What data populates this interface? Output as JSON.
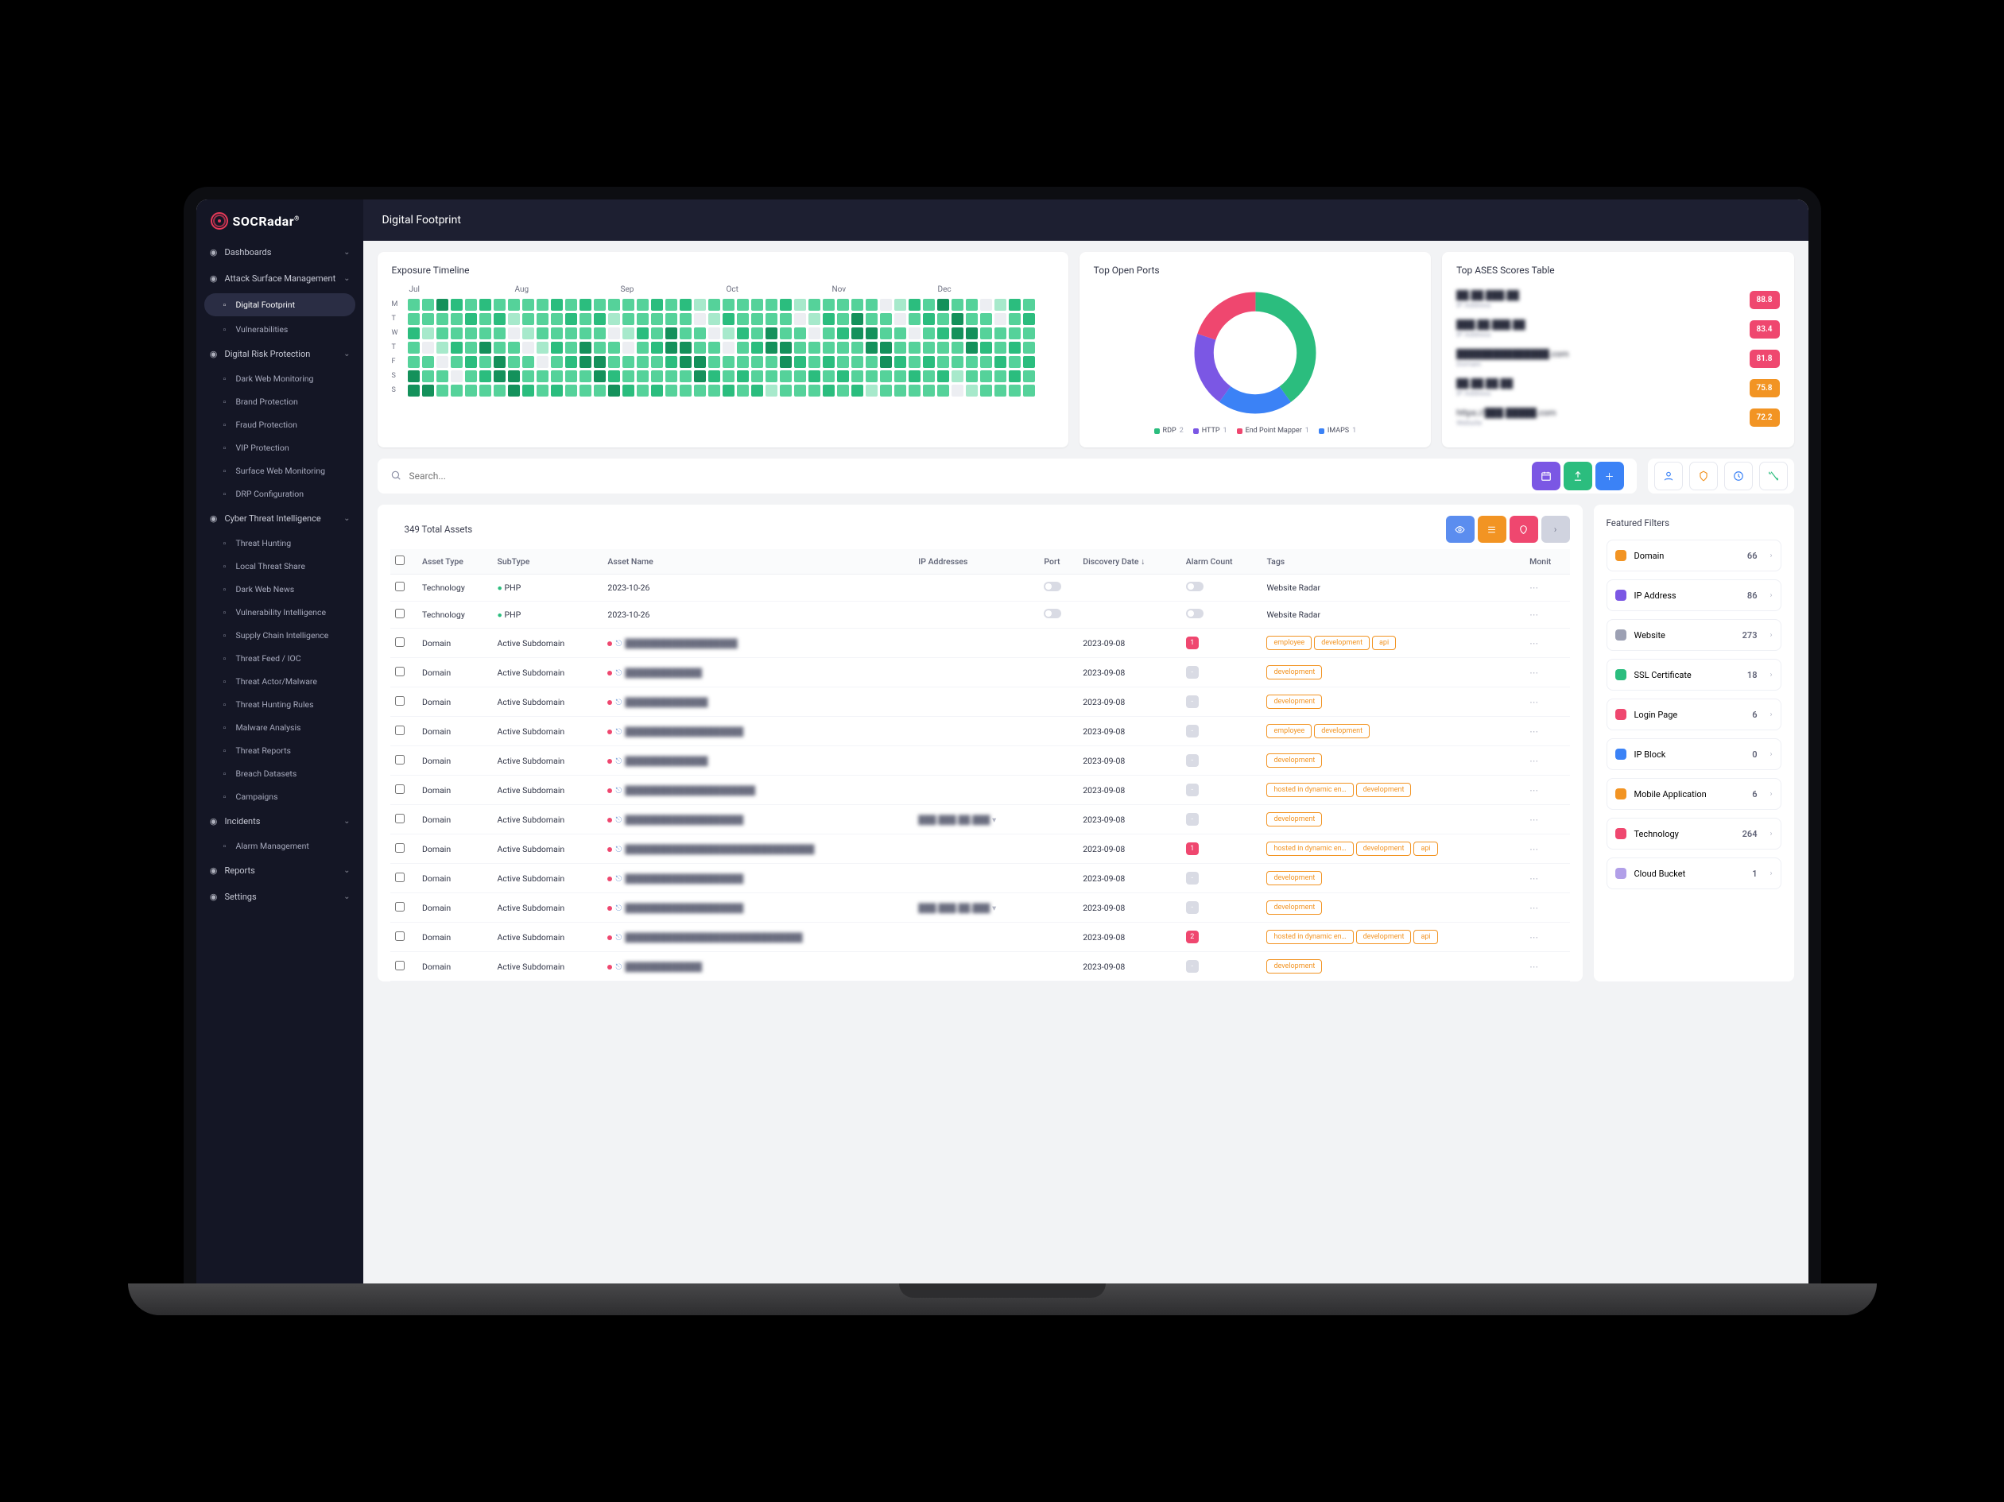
{
  "brand": "SOCRadar",
  "page_title": "Digital Footprint",
  "sidebar": {
    "groups": [
      {
        "label": "Dashboards",
        "icon": "gauge",
        "items": []
      },
      {
        "label": "Attack Surface Management",
        "icon": "target",
        "expanded": true,
        "items": [
          {
            "label": "Digital Footprint",
            "active": true
          },
          {
            "label": "Vulnerabilities"
          }
        ]
      },
      {
        "label": "Digital Risk Protection",
        "icon": "shield",
        "expanded": true,
        "items": [
          {
            "label": "Dark Web Monitoring"
          },
          {
            "label": "Brand Protection"
          },
          {
            "label": "Fraud Protection"
          },
          {
            "label": "VIP Protection"
          },
          {
            "label": "Surface Web Monitoring"
          },
          {
            "label": "DRP Configuration"
          }
        ]
      },
      {
        "label": "Cyber Threat Intelligence",
        "icon": "globe",
        "expanded": true,
        "items": [
          {
            "label": "Threat Hunting"
          },
          {
            "label": "Local Threat Share"
          },
          {
            "label": "Dark Web News"
          },
          {
            "label": "Vulnerability Intelligence"
          },
          {
            "label": "Supply Chain Intelligence"
          },
          {
            "label": "Threat Feed / IOC"
          },
          {
            "label": "Threat Actor/Malware"
          },
          {
            "label": "Threat Hunting Rules"
          },
          {
            "label": "Malware Analysis"
          },
          {
            "label": "Threat Reports"
          },
          {
            "label": "Breach Datasets"
          },
          {
            "label": "Campaigns"
          }
        ]
      },
      {
        "label": "Incidents",
        "icon": "alert",
        "expanded": true,
        "items": [
          {
            "label": "Alarm Management"
          }
        ]
      },
      {
        "label": "Reports",
        "icon": "doc",
        "items": []
      },
      {
        "label": "Settings",
        "icon": "gear",
        "items": []
      }
    ]
  },
  "cards": {
    "timeline": {
      "title": "Exposure Timeline",
      "months": [
        "Jul",
        "Aug",
        "Sep",
        "Oct",
        "Nov",
        "Dec"
      ],
      "days": [
        "M",
        "T",
        "W",
        "T",
        "F",
        "S",
        "S"
      ]
    },
    "ports": {
      "title": "Top Open Ports",
      "series": [
        {
          "name": "RDP",
          "value": 2,
          "color": "#2bbd7e"
        },
        {
          "name": "HTTP",
          "value": 1,
          "color": "#7b57e4"
        },
        {
          "name": "End Point Mapper",
          "value": 1,
          "color": "#ef476f"
        },
        {
          "name": "IMAPS",
          "value": 1,
          "color": "#3b82f6"
        }
      ]
    },
    "ases": {
      "title": "Top ASES Scores Table",
      "rows": [
        {
          "name": "██.██.███.██",
          "sub": "IP Address",
          "score": "88.8",
          "color": "#ef476f"
        },
        {
          "name": "███.██.███.██",
          "sub": "IP Address",
          "score": "83.4",
          "color": "#ef476f"
        },
        {
          "name": "███████████████.com",
          "sub": "Domain",
          "score": "81.8",
          "color": "#ef476f"
        },
        {
          "name": "██.██.██.██",
          "sub": "IP Address",
          "score": "75.8",
          "color": "#f29423"
        },
        {
          "name": "https://███.█████.com",
          "sub": "Website",
          "score": "72.2",
          "color": "#f29423"
        }
      ]
    }
  },
  "search": {
    "placeholder": "Search..."
  },
  "assets": {
    "total_label": "349 Total Assets",
    "headers": {
      "asset_type": "Asset Type",
      "subtype": "SubType",
      "asset_name": "Asset Name",
      "ip": "IP Addresses",
      "port": "Port",
      "discovery": "Discovery Date",
      "alarm": "Alarm Count",
      "tags": "Tags",
      "monit": "Monit"
    },
    "rows": [
      {
        "type": "Technology",
        "sub": "PHP",
        "name": "",
        "date": "2023-10-26",
        "alarm": "",
        "tags": [],
        "website": "Website Radar",
        "tech": true
      },
      {
        "type": "Technology",
        "sub": "PHP",
        "name": "",
        "date": "2023-10-26",
        "alarm": "",
        "tags": [],
        "website": "Website Radar",
        "tech": true
      },
      {
        "type": "Domain",
        "sub": "Active Subdomain",
        "name": "███████████████████",
        "date": "2023-09-08",
        "alarm": "1",
        "alarm_red": true,
        "tags": [
          "employee",
          "development",
          "api"
        ]
      },
      {
        "type": "Domain",
        "sub": "Active Subdomain",
        "name": "█████████████",
        "date": "2023-09-08",
        "alarm": "-",
        "tags": [
          "development"
        ]
      },
      {
        "type": "Domain",
        "sub": "Active Subdomain",
        "name": "██████████████",
        "date": "2023-09-08",
        "alarm": "-",
        "tags": [
          "development"
        ]
      },
      {
        "type": "Domain",
        "sub": "Active Subdomain",
        "name": "████████████████████",
        "date": "2023-09-08",
        "alarm": "-",
        "tags": [
          "employee",
          "development"
        ]
      },
      {
        "type": "Domain",
        "sub": "Active Subdomain",
        "name": "██████████████",
        "date": "2023-09-08",
        "alarm": "-",
        "tags": [
          "development"
        ]
      },
      {
        "type": "Domain",
        "sub": "Active Subdomain",
        "name": "██████████████████████",
        "date": "2023-09-08",
        "alarm": "-",
        "tags": [
          "hosted in dynamic en…",
          "development"
        ]
      },
      {
        "type": "Domain",
        "sub": "Active Subdomain",
        "name": "████████████████████",
        "ip": "███.███.██.███",
        "date": "2023-09-08",
        "alarm": "-",
        "tags": [
          "development"
        ]
      },
      {
        "type": "Domain",
        "sub": "Active Subdomain",
        "name": "████████████████████████████████",
        "date": "2023-09-08",
        "alarm": "1",
        "alarm_red": true,
        "tags": [
          "hosted in dynamic en…",
          "development",
          "api"
        ]
      },
      {
        "type": "Domain",
        "sub": "Active Subdomain",
        "name": "████████████████████",
        "date": "2023-09-08",
        "alarm": "-",
        "tags": [
          "development"
        ]
      },
      {
        "type": "Domain",
        "sub": "Active Subdomain",
        "name": "████████████████████",
        "ip": "███.███.██.███",
        "date": "2023-09-08",
        "alarm": "-",
        "tags": [
          "development"
        ]
      },
      {
        "type": "Domain",
        "sub": "Active Subdomain",
        "name": "██████████████████████████████",
        "date": "2023-09-08",
        "alarm": "2",
        "alarm_red": true,
        "tags": [
          "hosted in dynamic en…",
          "development",
          "api"
        ]
      },
      {
        "type": "Domain",
        "sub": "Active Subdomain",
        "name": "█████████████",
        "date": "2023-09-08",
        "alarm": "-",
        "tags": [
          "development"
        ]
      }
    ]
  },
  "filters": {
    "title": "Featured Filters",
    "items": [
      {
        "label": "Domain",
        "count": 66,
        "color": "#f29423"
      },
      {
        "label": "IP Address",
        "count": 86,
        "color": "#7b57e4"
      },
      {
        "label": "Website",
        "count": 273,
        "color": "#9ca0b3"
      },
      {
        "label": "SSL Certificate",
        "count": 18,
        "color": "#2bbd7e"
      },
      {
        "label": "Login Page",
        "count": 6,
        "color": "#ef476f"
      },
      {
        "label": "IP Block",
        "count": 0,
        "color": "#3b82f6"
      },
      {
        "label": "Mobile Application",
        "count": 6,
        "color": "#f29423"
      },
      {
        "label": "Technology",
        "count": 264,
        "color": "#ef476f"
      },
      {
        "label": "Cloud Bucket",
        "count": 1,
        "color": "#b19fe8"
      }
    ]
  },
  "chart_data": {
    "type": "pie",
    "title": "Top Open Ports",
    "series": [
      {
        "name": "RDP",
        "value": 2
      },
      {
        "name": "HTTP",
        "value": 1
      },
      {
        "name": "End Point Mapper",
        "value": 1
      },
      {
        "name": "IMAPS",
        "value": 1
      }
    ]
  }
}
